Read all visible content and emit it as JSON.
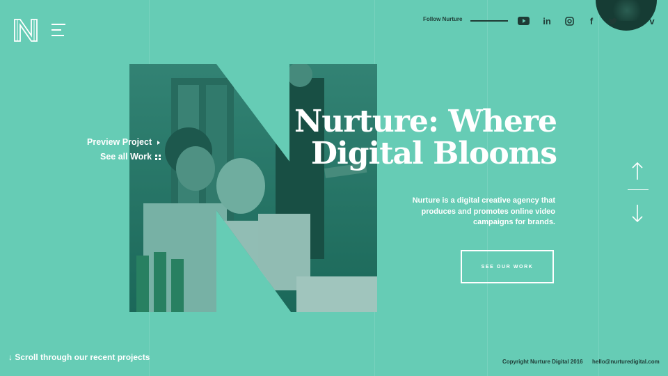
{
  "header": {
    "follow_label": "Follow Nurture",
    "social": [
      {
        "icon": "youtube-icon"
      },
      {
        "icon": "linkedin-icon",
        "glyph": "in"
      },
      {
        "icon": "instagram-icon"
      },
      {
        "icon": "facebook-icon",
        "glyph": "f"
      },
      {
        "icon": "twitter-icon"
      },
      {
        "icon": "vimeo-icon",
        "glyph": "v"
      }
    ]
  },
  "hero": {
    "headline_line1": "Nurture: Where",
    "headline_line2": "Digital Blooms",
    "description": "Nurture is a digital creative agency that produces and promotes online video campaigns for brands.",
    "cta_label": "SEE OUR WORK",
    "preview_link": "Preview Project",
    "all_work_link": "See all Work"
  },
  "footer": {
    "scroll_label": "Scroll through our recent projects",
    "copyright": "Copyright Nurture Digital 2016",
    "email": "hello@nurturedigital.com"
  },
  "colors": {
    "background": "#66ccb5",
    "text_light": "#ffffff",
    "text_dark": "#1f3b35",
    "photo_tint": "#1d6e5f"
  }
}
